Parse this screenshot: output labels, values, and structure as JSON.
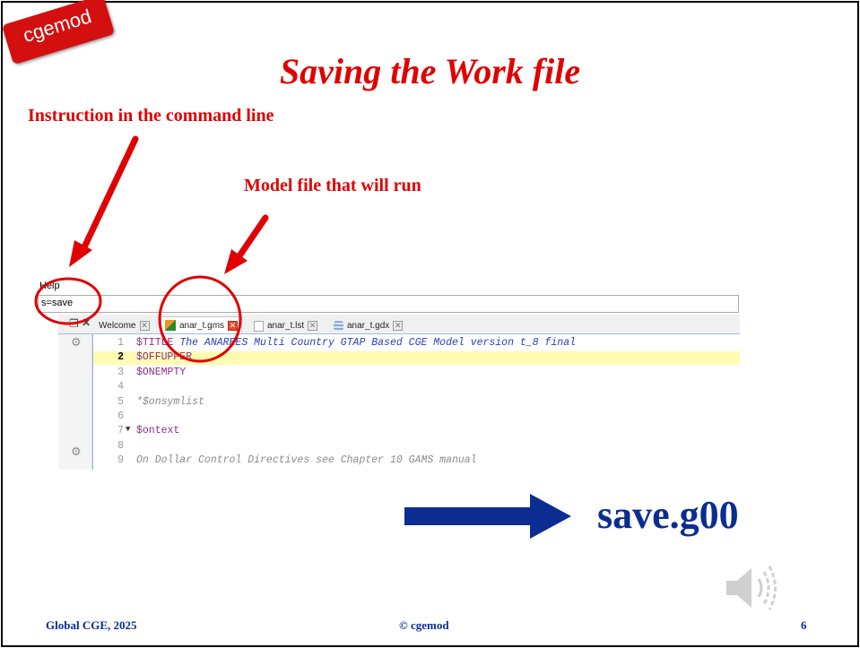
{
  "logo": {
    "text": "cgemod"
  },
  "title": "Saving the Work file",
  "annotations": {
    "command_line": "Instruction in the command line",
    "model_file": "Model file that will run"
  },
  "ide": {
    "menu": "Help",
    "command_value": "s=save",
    "tabs": [
      {
        "label": "Welcome",
        "active": false,
        "icon": "none"
      },
      {
        "label": "anar_t.gms",
        "active": true,
        "icon": "gms-file-icon"
      },
      {
        "label": "anar_t.lst",
        "active": false,
        "icon": "document-icon"
      },
      {
        "label": "anar_t.gdx",
        "active": false,
        "icon": "gdx-database-icon"
      }
    ],
    "lines": [
      {
        "n": "1",
        "parts": [
          [
            "c-dir",
            "$TITLE"
          ],
          [
            "c-dirblue",
            " The ANARRES Multi Country GTAP Based CGE Model version t_8 final"
          ]
        ]
      },
      {
        "n": "2",
        "current": true,
        "parts": [
          [
            "c-dir",
            "$OFFUPPER"
          ]
        ]
      },
      {
        "n": "3",
        "parts": [
          [
            "c-dir",
            "$ONEMPTY"
          ]
        ]
      },
      {
        "n": "4",
        "parts": []
      },
      {
        "n": "5",
        "parts": [
          [
            "c-cmt",
            "*$onsymlist"
          ]
        ]
      },
      {
        "n": "6",
        "parts": []
      },
      {
        "n": "7",
        "fold": true,
        "parts": [
          [
            "c-dir",
            "$ontext"
          ]
        ]
      },
      {
        "n": "8",
        "parts": []
      },
      {
        "n": "9",
        "parts": [
          [
            "c-cmt",
            "On Dollar Control Directives see Chapter 10 GAMS manual"
          ]
        ]
      }
    ]
  },
  "result": {
    "filename": "save.g00"
  },
  "footer": {
    "left": "Global CGE, 2025",
    "center": "© cgemod",
    "page": "6"
  },
  "colors": {
    "accent_red": "#e00000",
    "navy": "#0b2d92",
    "highlight_line": "#fffbb3"
  }
}
